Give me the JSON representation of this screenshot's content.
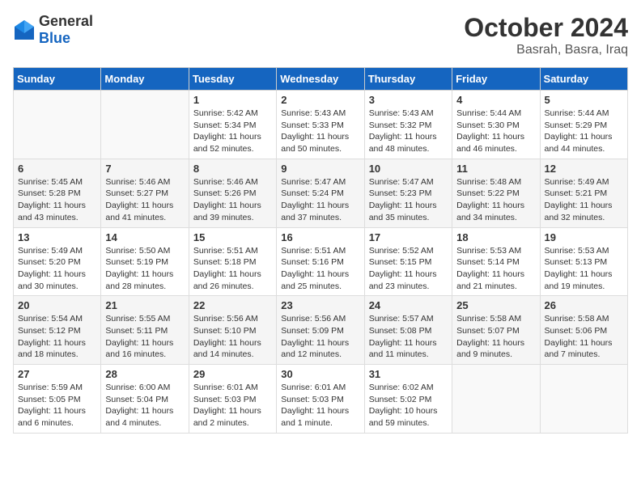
{
  "header": {
    "logo_general": "General",
    "logo_blue": "Blue",
    "month": "October 2024",
    "location": "Basrah, Basra, Iraq"
  },
  "weekdays": [
    "Sunday",
    "Monday",
    "Tuesday",
    "Wednesday",
    "Thursday",
    "Friday",
    "Saturday"
  ],
  "weeks": [
    [
      {
        "day": "",
        "content": ""
      },
      {
        "day": "",
        "content": ""
      },
      {
        "day": "1",
        "content": "Sunrise: 5:42 AM\nSunset: 5:34 PM\nDaylight: 11 hours and 52 minutes."
      },
      {
        "day": "2",
        "content": "Sunrise: 5:43 AM\nSunset: 5:33 PM\nDaylight: 11 hours and 50 minutes."
      },
      {
        "day": "3",
        "content": "Sunrise: 5:43 AM\nSunset: 5:32 PM\nDaylight: 11 hours and 48 minutes."
      },
      {
        "day": "4",
        "content": "Sunrise: 5:44 AM\nSunset: 5:30 PM\nDaylight: 11 hours and 46 minutes."
      },
      {
        "day": "5",
        "content": "Sunrise: 5:44 AM\nSunset: 5:29 PM\nDaylight: 11 hours and 44 minutes."
      }
    ],
    [
      {
        "day": "6",
        "content": "Sunrise: 5:45 AM\nSunset: 5:28 PM\nDaylight: 11 hours and 43 minutes."
      },
      {
        "day": "7",
        "content": "Sunrise: 5:46 AM\nSunset: 5:27 PM\nDaylight: 11 hours and 41 minutes."
      },
      {
        "day": "8",
        "content": "Sunrise: 5:46 AM\nSunset: 5:26 PM\nDaylight: 11 hours and 39 minutes."
      },
      {
        "day": "9",
        "content": "Sunrise: 5:47 AM\nSunset: 5:24 PM\nDaylight: 11 hours and 37 minutes."
      },
      {
        "day": "10",
        "content": "Sunrise: 5:47 AM\nSunset: 5:23 PM\nDaylight: 11 hours and 35 minutes."
      },
      {
        "day": "11",
        "content": "Sunrise: 5:48 AM\nSunset: 5:22 PM\nDaylight: 11 hours and 34 minutes."
      },
      {
        "day": "12",
        "content": "Sunrise: 5:49 AM\nSunset: 5:21 PM\nDaylight: 11 hours and 32 minutes."
      }
    ],
    [
      {
        "day": "13",
        "content": "Sunrise: 5:49 AM\nSunset: 5:20 PM\nDaylight: 11 hours and 30 minutes."
      },
      {
        "day": "14",
        "content": "Sunrise: 5:50 AM\nSunset: 5:19 PM\nDaylight: 11 hours and 28 minutes."
      },
      {
        "day": "15",
        "content": "Sunrise: 5:51 AM\nSunset: 5:18 PM\nDaylight: 11 hours and 26 minutes."
      },
      {
        "day": "16",
        "content": "Sunrise: 5:51 AM\nSunset: 5:16 PM\nDaylight: 11 hours and 25 minutes."
      },
      {
        "day": "17",
        "content": "Sunrise: 5:52 AM\nSunset: 5:15 PM\nDaylight: 11 hours and 23 minutes."
      },
      {
        "day": "18",
        "content": "Sunrise: 5:53 AM\nSunset: 5:14 PM\nDaylight: 11 hours and 21 minutes."
      },
      {
        "day": "19",
        "content": "Sunrise: 5:53 AM\nSunset: 5:13 PM\nDaylight: 11 hours and 19 minutes."
      }
    ],
    [
      {
        "day": "20",
        "content": "Sunrise: 5:54 AM\nSunset: 5:12 PM\nDaylight: 11 hours and 18 minutes."
      },
      {
        "day": "21",
        "content": "Sunrise: 5:55 AM\nSunset: 5:11 PM\nDaylight: 11 hours and 16 minutes."
      },
      {
        "day": "22",
        "content": "Sunrise: 5:56 AM\nSunset: 5:10 PM\nDaylight: 11 hours and 14 minutes."
      },
      {
        "day": "23",
        "content": "Sunrise: 5:56 AM\nSunset: 5:09 PM\nDaylight: 11 hours and 12 minutes."
      },
      {
        "day": "24",
        "content": "Sunrise: 5:57 AM\nSunset: 5:08 PM\nDaylight: 11 hours and 11 minutes."
      },
      {
        "day": "25",
        "content": "Sunrise: 5:58 AM\nSunset: 5:07 PM\nDaylight: 11 hours and 9 minutes."
      },
      {
        "day": "26",
        "content": "Sunrise: 5:58 AM\nSunset: 5:06 PM\nDaylight: 11 hours and 7 minutes."
      }
    ],
    [
      {
        "day": "27",
        "content": "Sunrise: 5:59 AM\nSunset: 5:05 PM\nDaylight: 11 hours and 6 minutes."
      },
      {
        "day": "28",
        "content": "Sunrise: 6:00 AM\nSunset: 5:04 PM\nDaylight: 11 hours and 4 minutes."
      },
      {
        "day": "29",
        "content": "Sunrise: 6:01 AM\nSunset: 5:03 PM\nDaylight: 11 hours and 2 minutes."
      },
      {
        "day": "30",
        "content": "Sunrise: 6:01 AM\nSunset: 5:03 PM\nDaylight: 11 hours and 1 minute."
      },
      {
        "day": "31",
        "content": "Sunrise: 6:02 AM\nSunset: 5:02 PM\nDaylight: 10 hours and 59 minutes."
      },
      {
        "day": "",
        "content": ""
      },
      {
        "day": "",
        "content": ""
      }
    ]
  ]
}
